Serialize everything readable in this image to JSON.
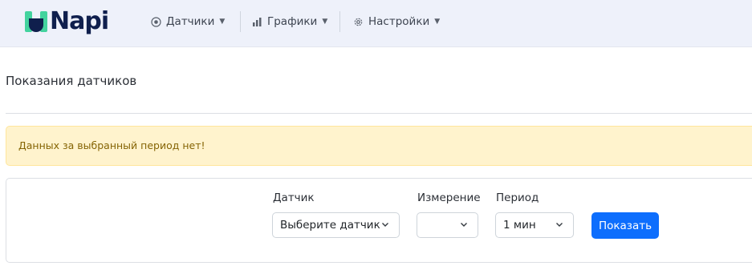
{
  "brand": {
    "name": "Napi",
    "colors": {
      "mark": "#43d39e",
      "text": "#0f1f4d"
    }
  },
  "nav": {
    "items": [
      {
        "label": "Датчики",
        "icon": "sensor-icon"
      },
      {
        "label": "Графики",
        "icon": "bar-chart-icon"
      },
      {
        "label": "Настройки",
        "icon": "gear-icon"
      }
    ]
  },
  "page": {
    "title": "Показания датчиков"
  },
  "alert": {
    "text": "Данных за выбранный период нет!",
    "type": "warning"
  },
  "form": {
    "sensor": {
      "label": "Датчик",
      "value": "Выберите датчик"
    },
    "measurement": {
      "label": "Измерение",
      "value": ""
    },
    "period": {
      "label": "Период",
      "value": "1 мин"
    },
    "submit_label": "Показать"
  },
  "colors": {
    "primary": "#0d6efd",
    "warning_bg": "#fff3cd",
    "warning_text": "#856404"
  }
}
